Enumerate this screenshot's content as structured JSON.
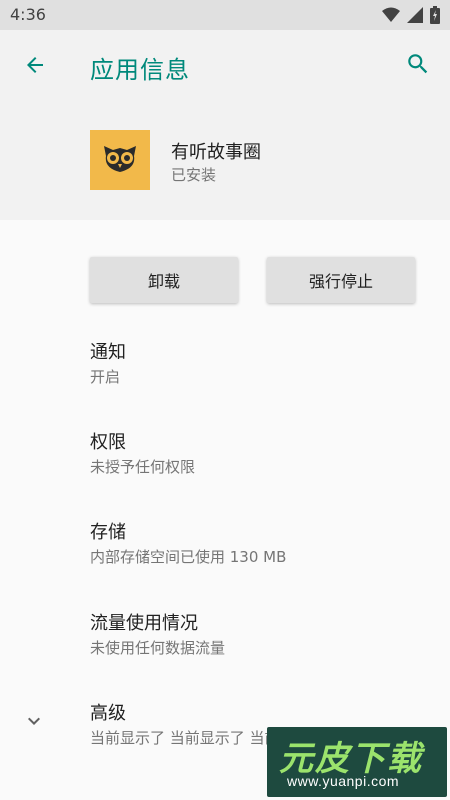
{
  "status_bar": {
    "time": "4:36"
  },
  "app_bar": {
    "title": "应用信息"
  },
  "app": {
    "name": "有听故事圈",
    "status": "已安装"
  },
  "buttons": {
    "uninstall": "卸载",
    "force_stop": "强行停止"
  },
  "prefs": [
    {
      "title": "通知",
      "summary": "开启"
    },
    {
      "title": "权限",
      "summary": "未授予任何权限"
    },
    {
      "title": "存储",
      "summary": "内部存储空间已使用 130 MB"
    },
    {
      "title": "流量使用情况",
      "summary": "未使用任何数据流量"
    },
    {
      "title": "高级",
      "summary": "当前显示了 当前显示了 当前显示了 电池"
    }
  ],
  "watermark": {
    "title": "元皮下载",
    "url": "www.yuanpi.com"
  },
  "colors": {
    "accent": "#00897b",
    "app_icon_bg": "#f2b94a"
  },
  "icons": [
    "wifi-icon",
    "signal-icon",
    "battery-icon",
    "back-arrow-icon",
    "search-icon",
    "owl-logo-icon",
    "chevron-down-icon"
  ]
}
